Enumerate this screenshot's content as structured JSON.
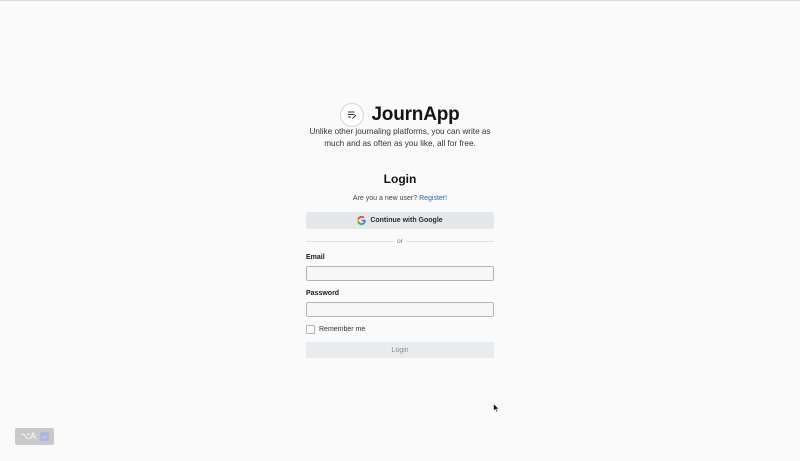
{
  "app": {
    "name": "JournApp",
    "tagline": "Unlike other journaling platforms, you can write as much and as often as you like, all for free.",
    "logo_icon": "notebook-pen-icon"
  },
  "login": {
    "title": "Login",
    "new_user_prompt": "Are you a new user?",
    "register_link": "Register!",
    "google_button": "Continue with Google",
    "divider_text": "or",
    "email_label": "Email",
    "email_value": "",
    "email_placeholder": "",
    "password_label": "Password",
    "password_value": "",
    "password_placeholder": "",
    "remember_me": "Remember me",
    "remember_me_checked": false,
    "submit_button": "Login"
  },
  "ime_indicator": {
    "label": "⌥A",
    "arrow": "→"
  },
  "colors": {
    "background": "#fafafa",
    "link": "#2f5fb5",
    "button_bg": "#e5e8eb"
  }
}
